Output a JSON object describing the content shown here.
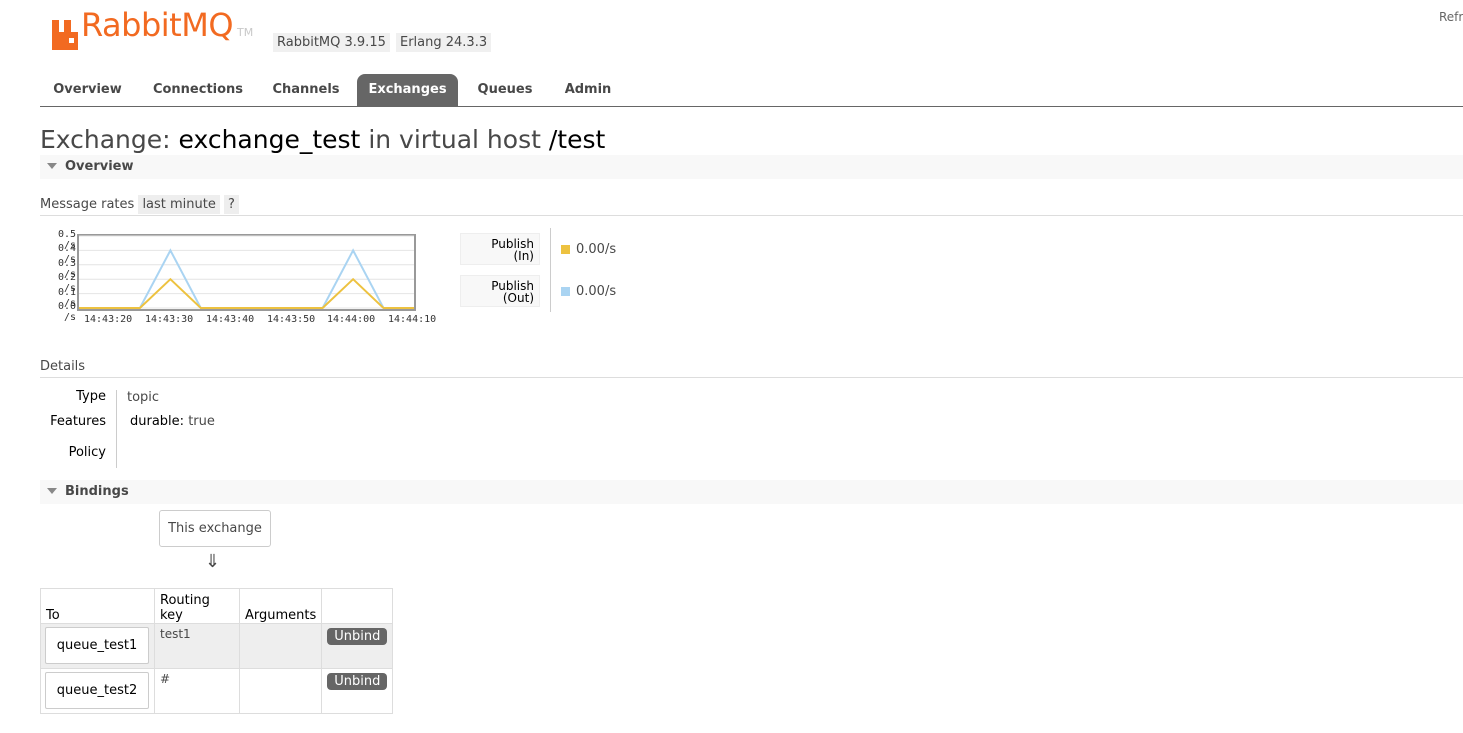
{
  "header": {
    "logo_text": "RabbitMQ",
    "logo_tm": "TM",
    "version_badge": "RabbitMQ 3.9.15",
    "erlang_badge": "Erlang 24.3.3",
    "refresh_label": "Refr"
  },
  "tabs": [
    {
      "label": "Overview",
      "active": false
    },
    {
      "label": "Connections",
      "active": false
    },
    {
      "label": "Channels",
      "active": false
    },
    {
      "label": "Exchanges",
      "active": true
    },
    {
      "label": "Queues",
      "active": false
    },
    {
      "label": "Admin",
      "active": false
    }
  ],
  "title": {
    "prefix": "Exchange:",
    "exchange_name": "exchange_test",
    "middle": "in virtual host",
    "vhost": "/test"
  },
  "overview_section": {
    "label": "Overview",
    "message_rates_label": "Message rates",
    "range_pill": "last minute",
    "help_pill": "?"
  },
  "chart_data": {
    "type": "line",
    "x": [
      "14:43:15",
      "14:43:20",
      "14:43:25",
      "14:43:30",
      "14:43:35",
      "14:43:40",
      "14:43:45",
      "14:43:50",
      "14:43:55",
      "14:44:00",
      "14:44:05",
      "14:44:10"
    ],
    "x_tick_labels": [
      "14:43:20",
      "14:43:30",
      "14:43:40",
      "14:43:50",
      "14:44:00",
      "14:44:10"
    ],
    "y_tick_labels": [
      "0.5 /s",
      "0.4 /s",
      "0.3 /s",
      "0.2 /s",
      "0.1 /s",
      "0.0 /s"
    ],
    "ylim": [
      0,
      0.5
    ],
    "grid": true,
    "series": [
      {
        "name": "Publish (Out)",
        "color": "#aad4f2",
        "values": [
          0,
          0,
          0,
          0.4,
          0,
          0,
          0,
          0,
          0,
          0.4,
          0,
          0
        ]
      },
      {
        "name": "Publish (In)",
        "color": "#edc240",
        "values": [
          0,
          0,
          0,
          0.2,
          0,
          0,
          0,
          0,
          0,
          0.2,
          0,
          0
        ]
      }
    ]
  },
  "legend": [
    {
      "line1": "Publish",
      "line2": "(In)",
      "color": "#edc240",
      "rate": "0.00/s"
    },
    {
      "line1": "Publish",
      "line2": "(Out)",
      "color": "#aad4f2",
      "rate": "0.00/s"
    }
  ],
  "details": {
    "heading": "Details",
    "type_label": "Type",
    "type_value": "topic",
    "features_label": "Features",
    "features_key": "durable:",
    "features_value": "true",
    "policy_label": "Policy",
    "policy_value": ""
  },
  "bindings_section": {
    "label": "Bindings",
    "this_exchange": "This exchange",
    "arrow": "⇓",
    "columns": [
      "To",
      "Routing key",
      "Arguments",
      ""
    ],
    "rows": [
      {
        "to": "queue_test1",
        "routing_key": "test1",
        "arguments": "",
        "action": "Unbind"
      },
      {
        "to": "queue_test2",
        "routing_key": "#",
        "arguments": "",
        "action": "Unbind"
      }
    ]
  }
}
